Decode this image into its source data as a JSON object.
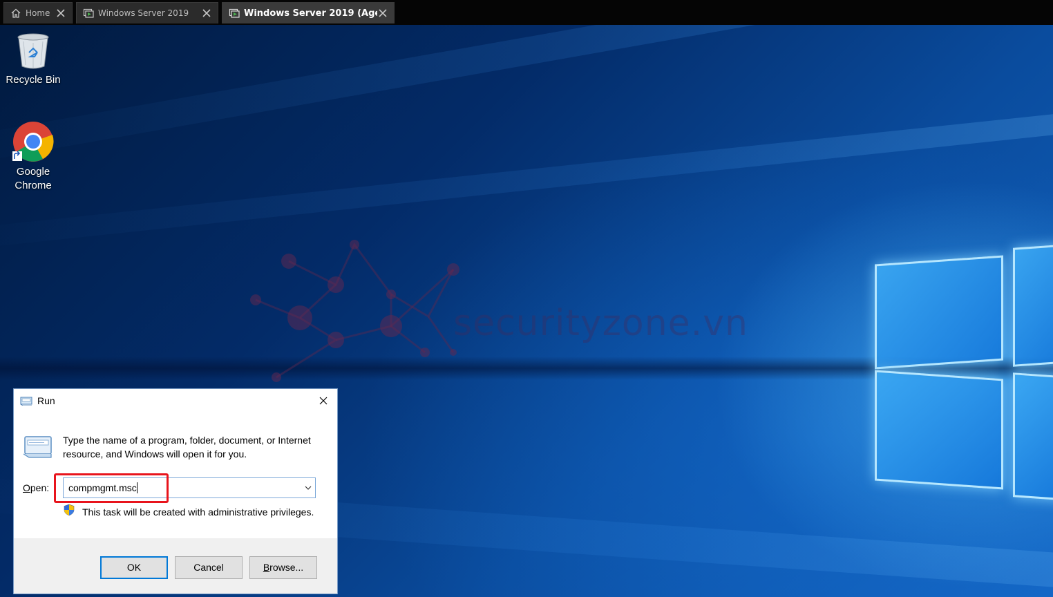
{
  "tabs": [
    {
      "label": "Home",
      "icon": "home-icon"
    },
    {
      "label": "Windows Server 2019",
      "icon": "vm-console-icon"
    },
    {
      "label": "Windows Server 2019 (Age...",
      "icon": "vm-console-icon",
      "active": true
    }
  ],
  "desktop": {
    "icons": [
      {
        "label": "Recycle Bin",
        "icon": "recycle-bin-icon"
      },
      {
        "label": "Google Chrome",
        "icon": "chrome-icon"
      }
    ],
    "watermark": "securityzone.vn"
  },
  "run_dialog": {
    "title": "Run",
    "description": "Type the name of a program, folder, document, or Internet resource, and Windows will open it for you.",
    "open_label_accel": "O",
    "open_label_rest": "pen:",
    "open_value": "compmgmt.msc",
    "admin_note": "This task will be created with administrative privileges.",
    "buttons": {
      "ok": "OK",
      "cancel": "Cancel",
      "browse_accel": "B",
      "browse_rest": "rowse..."
    },
    "highlight_color": "#e8141c"
  }
}
